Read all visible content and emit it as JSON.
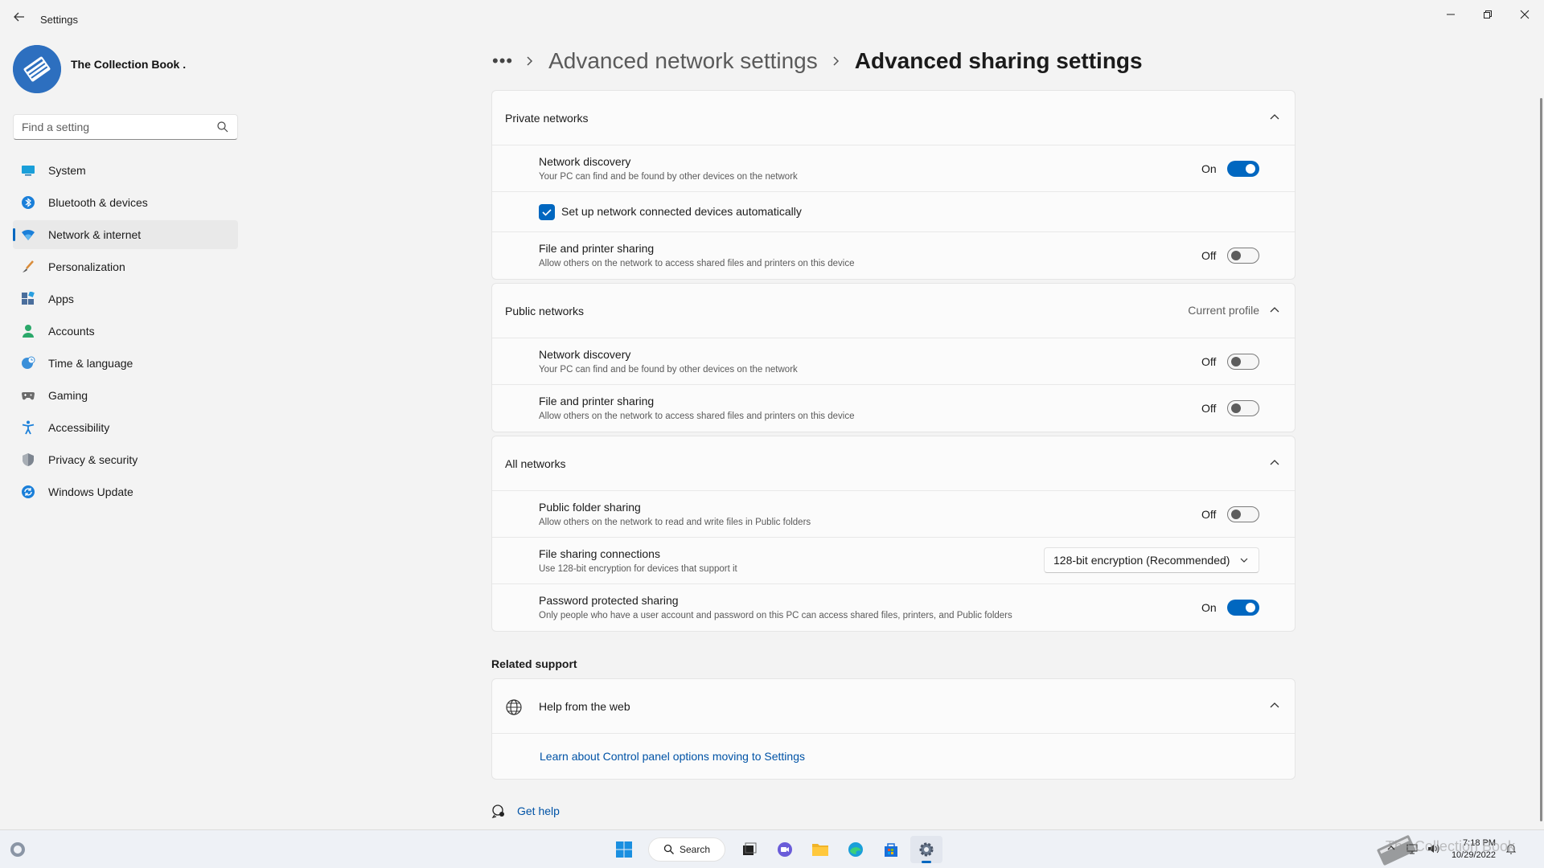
{
  "window": {
    "app_title": "Settings",
    "back_icon": "arrow-left-icon",
    "controls": [
      "minimize-icon",
      "restore-icon",
      "close-icon"
    ]
  },
  "profile": {
    "name": "The Collection Book ."
  },
  "search": {
    "placeholder": "Find a setting"
  },
  "sidebar": {
    "items": [
      {
        "label": "System",
        "icon": "monitor-icon"
      },
      {
        "label": "Bluetooth & devices",
        "icon": "bluetooth-icon"
      },
      {
        "label": "Network & internet",
        "icon": "wifi-icon",
        "active": true
      },
      {
        "label": "Personalization",
        "icon": "brush-icon"
      },
      {
        "label": "Apps",
        "icon": "apps-icon"
      },
      {
        "label": "Accounts",
        "icon": "person-icon"
      },
      {
        "label": "Time & language",
        "icon": "globe-clock-icon"
      },
      {
        "label": "Gaming",
        "icon": "gamepad-icon"
      },
      {
        "label": "Accessibility",
        "icon": "accessibility-icon"
      },
      {
        "label": "Privacy & security",
        "icon": "shield-icon"
      },
      {
        "label": "Windows Update",
        "icon": "update-icon"
      }
    ]
  },
  "breadcrumb": {
    "more": "•••",
    "parent": "Advanced network settings",
    "current": "Advanced sharing settings"
  },
  "private": {
    "header": "Private networks",
    "discovery": {
      "title": "Network discovery",
      "desc": "Your PC can find and be found by other devices on the network",
      "state": "On"
    },
    "auto_setup": {
      "label": "Set up network connected devices automatically",
      "checked": true
    },
    "file_sharing": {
      "title": "File and printer sharing",
      "desc": "Allow others on the network to access shared files and printers on this device",
      "state": "Off"
    }
  },
  "public": {
    "header": "Public networks",
    "tag": "Current profile",
    "discovery": {
      "title": "Network discovery",
      "desc": "Your PC can find and be found by other devices on the network",
      "state": "Off"
    },
    "file_sharing": {
      "title": "File and printer sharing",
      "desc": "Allow others on the network to access shared files and printers on this device",
      "state": "Off"
    }
  },
  "all": {
    "header": "All networks",
    "public_folder": {
      "title": "Public folder sharing",
      "desc": "Allow others on the network to read and write files in Public folders",
      "state": "Off"
    },
    "file_connections": {
      "title": "File sharing connections",
      "desc": "Use 128-bit encryption for devices that support it",
      "selected": "128-bit encryption (Recommended)"
    },
    "password": {
      "title": "Password protected sharing",
      "desc": "Only people who have a user account and password on this PC can access shared files, printers, and Public folders",
      "state": "On"
    }
  },
  "related": {
    "title": "Related support",
    "help_header": "Help from the web",
    "link": "Learn about Control panel options moving to Settings"
  },
  "get_help": "Get help",
  "taskbar": {
    "search_label": "Search",
    "time": "7:18 PM",
    "date": "10/29/2022",
    "watermark": "The Collection Book"
  },
  "colors": {
    "accent": "#0067c0",
    "link": "#0053a6",
    "background": "#f3f3f3",
    "card": "#fbfbfb"
  }
}
